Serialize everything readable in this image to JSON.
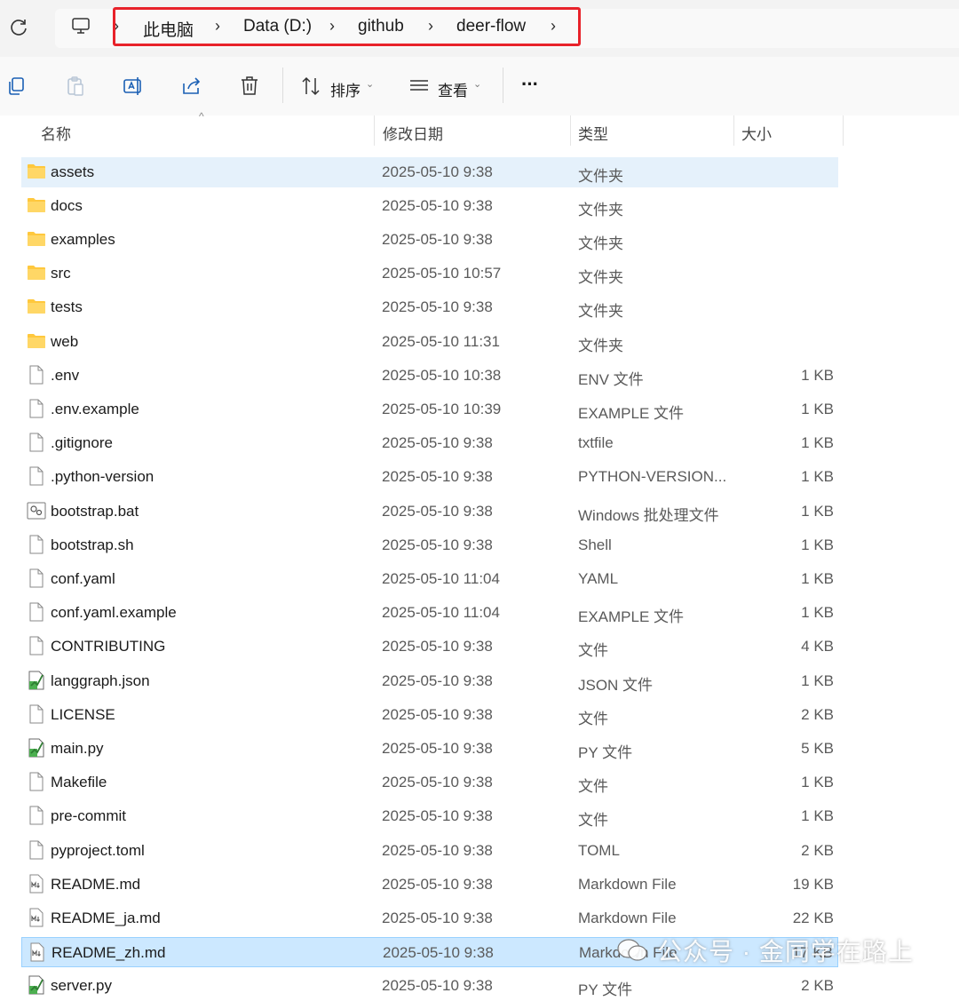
{
  "breadcrumb": {
    "items": [
      "此电脑",
      "Data (D:)",
      "github",
      "deer-flow"
    ]
  },
  "toolbar": {
    "sort_label": "排序",
    "view_label": "查看",
    "more_label": "···"
  },
  "columns": {
    "name": "名称",
    "date": "修改日期",
    "type": "类型",
    "size": "大小"
  },
  "files": [
    {
      "name": "assets",
      "date": "2025-05-10 9:38",
      "type": "文件夹",
      "size": "",
      "icon": "folder-icon"
    },
    {
      "name": "docs",
      "date": "2025-05-10 9:38",
      "type": "文件夹",
      "size": "",
      "icon": "folder-icon"
    },
    {
      "name": "examples",
      "date": "2025-05-10 9:38",
      "type": "文件夹",
      "size": "",
      "icon": "folder-icon"
    },
    {
      "name": "src",
      "date": "2025-05-10 10:57",
      "type": "文件夹",
      "size": "",
      "icon": "folder-icon"
    },
    {
      "name": "tests",
      "date": "2025-05-10 9:38",
      "type": "文件夹",
      "size": "",
      "icon": "folder-icon"
    },
    {
      "name": "web",
      "date": "2025-05-10 11:31",
      "type": "文件夹",
      "size": "",
      "icon": "folder-icon"
    },
    {
      "name": ".env",
      "date": "2025-05-10 10:38",
      "type": "ENV 文件",
      "size": "1 KB",
      "icon": "file-icon"
    },
    {
      "name": ".env.example",
      "date": "2025-05-10 10:39",
      "type": "EXAMPLE 文件",
      "size": "1 KB",
      "icon": "file-icon"
    },
    {
      "name": ".gitignore",
      "date": "2025-05-10 9:38",
      "type": "txtfile",
      "size": "1 KB",
      "icon": "file-icon"
    },
    {
      "name": ".python-version",
      "date": "2025-05-10 9:38",
      "type": "PYTHON-VERSION...",
      "size": "1 KB",
      "icon": "file-icon"
    },
    {
      "name": "bootstrap.bat",
      "date": "2025-05-10 9:38",
      "type": "Windows 批处理文件",
      "size": "1 KB",
      "icon": "batch-file-icon"
    },
    {
      "name": "bootstrap.sh",
      "date": "2025-05-10 9:38",
      "type": "Shell",
      "size": "1 KB",
      "icon": "file-icon"
    },
    {
      "name": "conf.yaml",
      "date": "2025-05-10 11:04",
      "type": "YAML",
      "size": "1 KB",
      "icon": "file-icon"
    },
    {
      "name": "conf.yaml.example",
      "date": "2025-05-10 11:04",
      "type": "EXAMPLE 文件",
      "size": "1 KB",
      "icon": "file-icon"
    },
    {
      "name": "CONTRIBUTING",
      "date": "2025-05-10 9:38",
      "type": "文件",
      "size": "4 KB",
      "icon": "file-icon"
    },
    {
      "name": "langgraph.json",
      "date": "2025-05-10 9:38",
      "type": "JSON 文件",
      "size": "1 KB",
      "icon": "script-file-icon"
    },
    {
      "name": "LICENSE",
      "date": "2025-05-10 9:38",
      "type": "文件",
      "size": "2 KB",
      "icon": "file-icon"
    },
    {
      "name": "main.py",
      "date": "2025-05-10 9:38",
      "type": "PY 文件",
      "size": "5 KB",
      "icon": "script-file-icon"
    },
    {
      "name": "Makefile",
      "date": "2025-05-10 9:38",
      "type": "文件",
      "size": "1 KB",
      "icon": "file-icon"
    },
    {
      "name": "pre-commit",
      "date": "2025-05-10 9:38",
      "type": "文件",
      "size": "1 KB",
      "icon": "file-icon"
    },
    {
      "name": "pyproject.toml",
      "date": "2025-05-10 9:38",
      "type": "TOML",
      "size": "2 KB",
      "icon": "file-icon"
    },
    {
      "name": "README.md",
      "date": "2025-05-10 9:38",
      "type": "Markdown File",
      "size": "19 KB",
      "icon": "markdown-file-icon"
    },
    {
      "name": "README_ja.md",
      "date": "2025-05-10 9:38",
      "type": "Markdown File",
      "size": "22 KB",
      "icon": "markdown-file-icon"
    },
    {
      "name": "README_zh.md",
      "date": "2025-05-10 9:38",
      "type": "Markdown File",
      "size": "17 KB",
      "icon": "markdown-file-icon"
    },
    {
      "name": "server.py",
      "date": "2025-05-10 9:38",
      "type": "PY 文件",
      "size": "2 KB",
      "icon": "script-file-icon"
    }
  ],
  "watermark": "公众号 · 金同学在路上",
  "colors": {
    "highlight_box": "#e8222a",
    "selection": "#cce8ff",
    "hover": "#e5f1fb",
    "folder": "#ffc83d"
  }
}
